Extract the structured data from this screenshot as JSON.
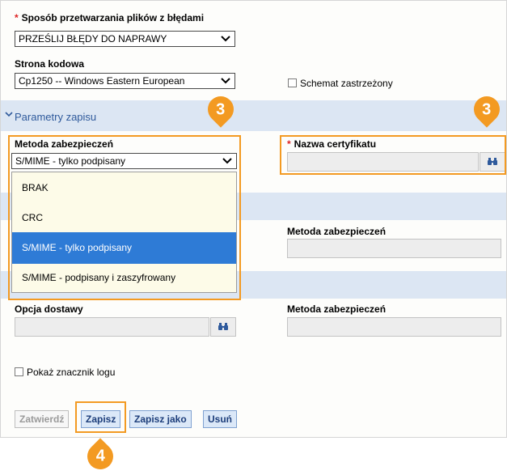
{
  "error_mode": {
    "label": "Sposób przetwarzania plików z błędami",
    "value": "PRZEŚLIJ BŁĘDY DO NAPRAWY"
  },
  "code_page": {
    "label": "Strona kodowa",
    "value": "Cp1250 -- Windows Eastern European"
  },
  "reserved_schema": {
    "label": "Schemat zastrzeżony",
    "checked": false
  },
  "section_save": {
    "title": "Parametry zapisu"
  },
  "security_method": {
    "label": "Metoda zabezpieczeń",
    "value": "S/MIME - tylko podpisany",
    "options": [
      "BRAK",
      "CRC",
      "S/MIME - tylko podpisany",
      "S/MIME - podpisany i zaszyfrowany"
    ],
    "selected_index": 2
  },
  "certificate_name": {
    "label": "Nazwa certyfikatu",
    "value": ""
  },
  "security_method_2": {
    "label": "Metoda zabezpieczeń",
    "value": ""
  },
  "delivery_option": {
    "label": "Opcja dostawy",
    "value": ""
  },
  "security_method_3": {
    "label": "Metoda zabezpieczeń",
    "value": ""
  },
  "show_log_marker": {
    "label": "Pokaż znacznik logu",
    "checked": false
  },
  "buttons": {
    "confirm": "Zatwierdź",
    "save": "Zapisz",
    "save_as": "Zapisz jako",
    "delete": "Usuń"
  },
  "callouts": {
    "dropdown_step": "3",
    "certificate_step": "3",
    "save_step": "4"
  },
  "colors": {
    "accent": "#f39a22",
    "section_bg": "#dce6f3",
    "section_text": "#2f5a9c",
    "selected_option": "#2e7bd6"
  }
}
